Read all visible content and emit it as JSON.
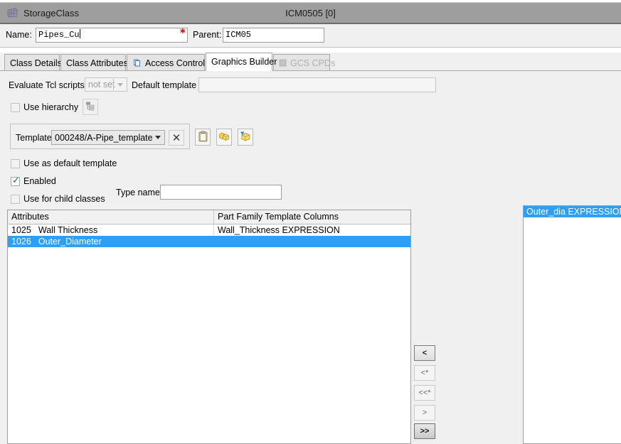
{
  "window": {
    "title": "StorageClass",
    "center_title": "ICM0505 [0]",
    "icon": "table-grid-icon"
  },
  "header": {
    "name_label": "Name:",
    "name_value": "Pipes_Cu",
    "name_required_marker": "*",
    "parent_label": "Parent:",
    "parent_value": "ICM05"
  },
  "tabs": [
    {
      "label": "Class Details",
      "active": false,
      "disabled": false
    },
    {
      "label": "Class Attributes",
      "active": false,
      "disabled": false
    },
    {
      "label": "Access Control",
      "active": false,
      "disabled": false,
      "icon": "pages-icon"
    },
    {
      "label": "Graphics Builder",
      "active": true,
      "disabled": false
    },
    {
      "label": "GCS CPDs",
      "active": false,
      "disabled": true,
      "icon": "square-icon"
    }
  ],
  "graphics_builder": {
    "evaluate_tcl_label": "Evaluate Tcl scripts",
    "evaluate_tcl_value": "not set",
    "default_template_label": "Default template",
    "default_template_value": "",
    "use_hierarchy_label": "Use hierarchy",
    "use_hierarchy_checked": false,
    "hierarchy_button_icon": "hierarchy-tree-icon",
    "template_label": "Template",
    "template_value": "000248/A-Pipe_template",
    "clear_template_label": "✕",
    "template_buttons": [
      {
        "icon": "clipboard-paste-icon"
      },
      {
        "icon": "cubes-icon"
      },
      {
        "icon": "cube-arrow-icon"
      }
    ],
    "use_as_default_template_label": "Use as default template",
    "use_as_default_template_checked": false,
    "enabled_label": "Enabled",
    "enabled_checked": true,
    "enabled_check_glyph": "✓",
    "use_for_child_classes_label": "Use for child classes",
    "use_for_child_classes_checked": false,
    "type_name_label": "Type name",
    "type_name_value": ""
  },
  "attributes_table": {
    "columns": [
      "Attributes",
      "Part Family Template Columns"
    ],
    "rows": [
      {
        "id": "1025",
        "attribute": "Wall Thickness",
        "template_column": "Wall_Thickness   EXPRESSION",
        "selected": false
      },
      {
        "id": "1026",
        "attribute": "Outer_Diameter",
        "template_column": "",
        "selected": true
      }
    ]
  },
  "transfer_buttons": [
    {
      "label": "<",
      "state": "enabled"
    },
    {
      "label": "<*",
      "state": "disabled"
    },
    {
      "label": "<<*",
      "state": "disabled"
    },
    {
      "label": ">",
      "state": "disabled"
    },
    {
      "label": ">>",
      "state": "strong"
    }
  ],
  "available_columns_list": {
    "rows": [
      {
        "label": "Outer_dia   EXPRESSION",
        "selected": true
      }
    ]
  },
  "colors": {
    "selection_blue": "#2f9ef5",
    "titlebar_grey": "#9e9e9e",
    "panel_grey": "#f0f0f0",
    "required_red": "#cc0000"
  }
}
